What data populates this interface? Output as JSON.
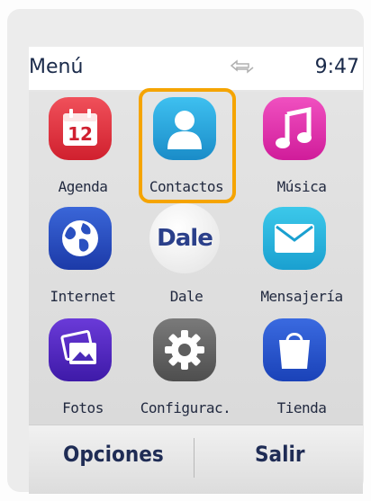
{
  "status": {
    "title": "Menú",
    "time": "9:47"
  },
  "apps": [
    {
      "label": "Agenda",
      "icon": "calendar-icon",
      "badge": "12"
    },
    {
      "label": "Contactos",
      "icon": "contacts-icon"
    },
    {
      "label": "Música",
      "icon": "music-icon"
    },
    {
      "label": "Internet",
      "icon": "globe-icon"
    },
    {
      "label": "Dale",
      "icon": "dale-icon",
      "logo_text": "Dale"
    },
    {
      "label": "Mensajería",
      "icon": "envelope-icon"
    },
    {
      "label": "Fotos",
      "icon": "photos-icon"
    },
    {
      "label": "Configurac.",
      "icon": "gear-icon"
    },
    {
      "label": "Tienda",
      "icon": "shopping-bag-icon"
    }
  ],
  "selected_app": "Contactos",
  "softkeys": {
    "left": "Opciones",
    "right": "Salir"
  },
  "colors": {
    "selection": "#f5a400",
    "label_text": "#222a40"
  }
}
